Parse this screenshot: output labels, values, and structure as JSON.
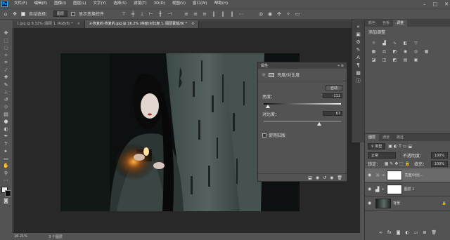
{
  "app": {
    "logo": "Ps"
  },
  "menu": [
    "文件(F)",
    "编辑(E)",
    "图像(I)",
    "图层(L)",
    "文字(Y)",
    "选择(S)",
    "滤镜(T)",
    "3D(D)",
    "视图(V)",
    "窗口(W)",
    "帮助(H)"
  ],
  "options": {
    "auto_select_label": "自动选择：",
    "auto_select_value": "图层",
    "transform_label": "显示变换控件"
  },
  "tabs": [
    {
      "label": "1.jpg @ 8.32% (图层 1, RGB/8) *",
      "active": false
    },
    {
      "label": "2-恢复的-恢复的.jpg @ 16.2% (亮度/对比度 1, 图层蒙版/8) *",
      "active": true
    }
  ],
  "status": {
    "zoom": "16.21%",
    "info": "3 个图层"
  },
  "properties": {
    "title": "属性",
    "section": "亮度/对比度",
    "auto": "自动",
    "brightness_label": "亮度：",
    "brightness_value": "-111",
    "brightness_level": 0.05,
    "contrast_label": "对比度：",
    "contrast_value": "67",
    "contrast_level": 0.72,
    "legacy": "使用旧版"
  },
  "adjust_panel": {
    "tabs": [
      "颜色",
      "色板",
      "调整"
    ],
    "add_label": "添加调整"
  },
  "layers_panel": {
    "tabs": [
      "图层",
      "通道",
      "路径"
    ],
    "kind": "类型",
    "blend": "正常",
    "opacity_label": "不透明度：",
    "opacity": "100%",
    "lock_label": "锁定：",
    "fill_label": "填充：",
    "fill": "100%",
    "layers": [
      {
        "name": "亮度/对比...",
        "type": "adjust"
      },
      {
        "name": "图层 1",
        "type": "levels"
      },
      {
        "name": "背景",
        "type": "photo"
      }
    ]
  }
}
